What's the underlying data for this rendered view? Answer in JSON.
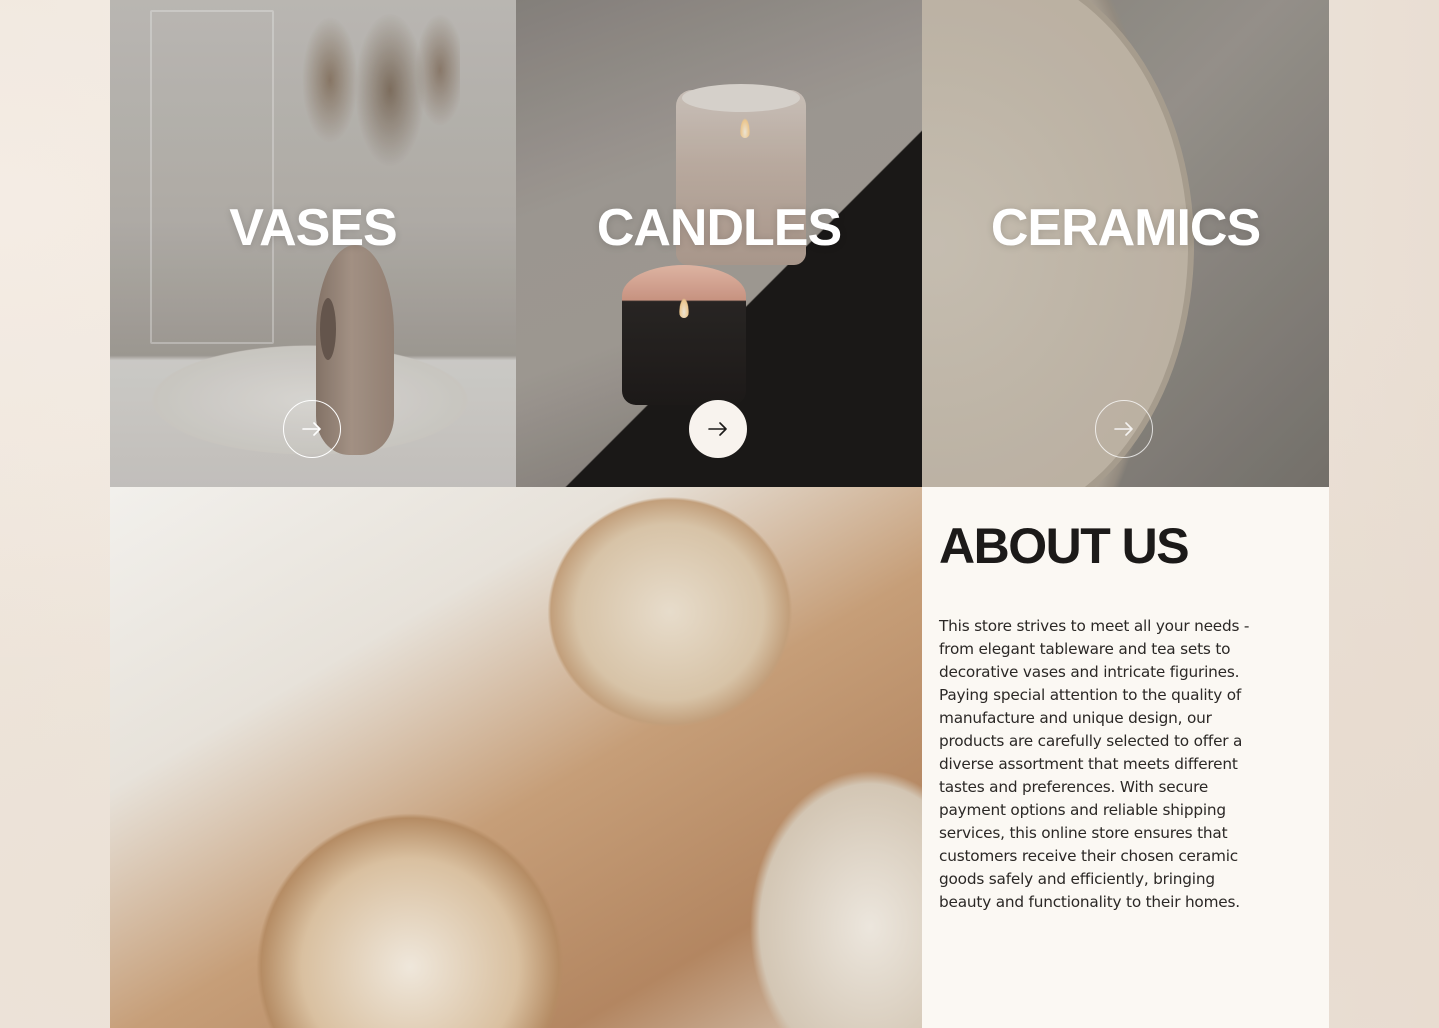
{
  "categories": [
    {
      "title": "VASES",
      "button_icon": "arrow-right-icon",
      "active": false
    },
    {
      "title": "CANDLES",
      "button_icon": "arrow-right-icon",
      "active": true
    },
    {
      "title": "CERAMICS",
      "button_icon": "arrow-right-icon",
      "active": false
    }
  ],
  "about": {
    "title": "ABOUT US",
    "body": "This store strives to meet all your needs - from elegant tableware and tea sets to decorative vases and intricate figurines. Paying special attention to the quality of manufacture and unique design, our products are carefully selected to offer a diverse assortment that meets different tastes and preferences. With secure payment options and reliable shipping services, this online store ensures that customers receive their chosen ceramic goods safely and efficiently, bringing beauty and functionality to their homes."
  },
  "colors": {
    "accent_button_fill": "#f8f3ee",
    "about_background": "#fbf8f3",
    "heading_text": "#1c1a19"
  }
}
